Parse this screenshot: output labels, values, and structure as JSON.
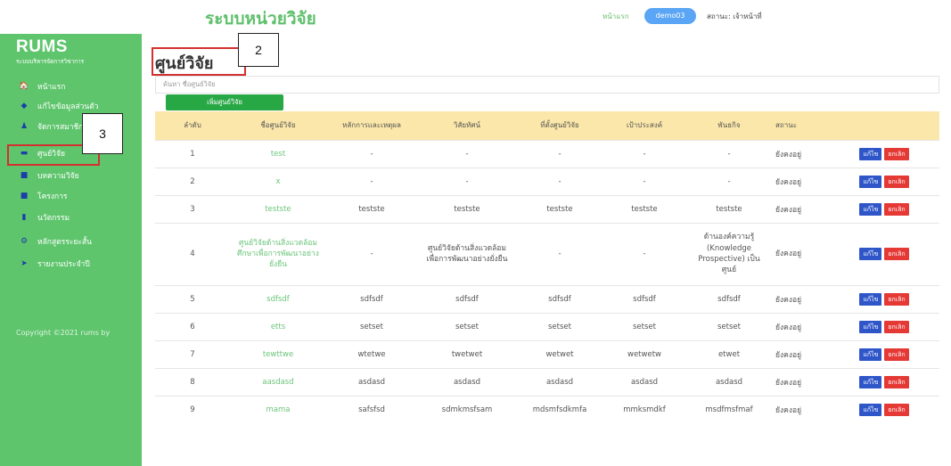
{
  "header": {
    "site_title": "ระบบหน่วยวิจัย",
    "home_link": "หน้าแรก",
    "user": "demo03",
    "status": "สถานะ: เจ้าหน้าที่"
  },
  "sidebar": {
    "brand": "RUMS",
    "brand_sub": "ระบบบริหารจัดการวิชาการ",
    "items": [
      {
        "label": "หน้าแรก",
        "icon": "home-icon",
        "glyph": "🏠"
      },
      {
        "label": "แก้ไขข้อมูลส่วนตัว",
        "icon": "gear-icon",
        "glyph": "◆"
      },
      {
        "label": "จัดการสมาชิก",
        "icon": "user-icon",
        "glyph": "♟"
      },
      {
        "label": "ศูนย์วิจัย",
        "icon": "building-icon",
        "glyph": "▬"
      },
      {
        "label": "บทความวิจัย",
        "icon": "book-icon",
        "glyph": "■"
      },
      {
        "label": "โครงการ",
        "icon": "folder-icon",
        "glyph": "■"
      },
      {
        "label": "นวัตกรรม",
        "icon": "bulb-icon",
        "glyph": "▮"
      },
      {
        "label": "หลักสูตรระยะสั้น",
        "icon": "cogs-icon",
        "glyph": "⚙"
      },
      {
        "label": "รายงานประจำปี",
        "icon": "send-icon",
        "glyph": "➤"
      }
    ],
    "copyright": "Copyright ©2021 rums by"
  },
  "main": {
    "title": "ศูนย์วิจัย",
    "search_placeholder": "ค้นหา ชื่อศูนย์วิจัย",
    "add_button": "เพิ่มศูนย์วิจัย",
    "columns": [
      "ลำดับ",
      "ชื่อศูนย์วิจัย",
      "หลักการและเหตุผล",
      "วิสัยทัศน์",
      "ที่ตั้งศูนย์วิจัย",
      "เป้าประสงค์",
      "พันธกิจ",
      "สถานะ",
      ""
    ],
    "edit_label": "แก้ไข",
    "delete_label": "ยกเลิก",
    "rows": [
      {
        "no": "1",
        "name": "test",
        "rationale": "-",
        "vision": "-",
        "location": "-",
        "goal": "-",
        "mission": "-",
        "status": "ยังคงอยู่"
      },
      {
        "no": "2",
        "name": "x",
        "rationale": "-",
        "vision": "-",
        "location": "-",
        "goal": "-",
        "mission": "-",
        "status": "ยังคงอยู่"
      },
      {
        "no": "3",
        "name": "teststе",
        "rationale": "teststе",
        "vision": "teststе",
        "location": "teststе",
        "goal": "teststе",
        "mission": "teststе",
        "status": "ยังคงอยู่"
      },
      {
        "no": "4",
        "name": "ศูนย์วิจัยด้านสิ่งแวดล้อมศึกษาเพื่อการพัฒนาอย่างยั่งยืน",
        "rationale": "-",
        "vision": "ศูนย์วิจัยด้านสิ่งแวดล้อมเพื่อการพัฒนาอย่างยั่งยืน",
        "location": "-",
        "goal": "-",
        "mission": "ด้านองค์ความรู้ (Knowledge Prospective) เป็นศูนย์",
        "status": "ยังคงอยู่"
      },
      {
        "no": "5",
        "name": "sdfsdf",
        "rationale": "sdfsdf",
        "vision": "sdfsdf",
        "location": "sdfsdf",
        "goal": "sdfsdf",
        "mission": "sdfsdf",
        "status": "ยังคงอยู่"
      },
      {
        "no": "6",
        "name": "etts",
        "rationale": "setset",
        "vision": "setset",
        "location": "setset",
        "goal": "setset",
        "mission": "setset",
        "status": "ยังคงอยู่"
      },
      {
        "no": "7",
        "name": "tewttwe",
        "rationale": "wtetwe",
        "vision": "twetwet",
        "location": "wetwet",
        "goal": "wetwetw",
        "mission": "etwet",
        "status": "ยังคงอยู่"
      },
      {
        "no": "8",
        "name": "aasdasd",
        "rationale": "asdasd",
        "vision": "asdasd",
        "location": "asdasd",
        "goal": "asdasd",
        "mission": "asdasd",
        "status": "ยังคงอยู่"
      },
      {
        "no": "9",
        "name": "mama",
        "rationale": "safsfsd",
        "vision": "sdmkmsfsam",
        "location": "mdsmfsdkmfa",
        "goal": "mmksmdkf",
        "mission": "msdfmsfmaf",
        "status": "ยังคงอยู่"
      }
    ]
  },
  "annotations": [
    {
      "label": "2",
      "target": "page-title"
    },
    {
      "label": "3",
      "target": "sidebar-item-research-center"
    }
  ],
  "colors": {
    "sidebar": "#5fc56d",
    "header_row": "#fbe7a9",
    "edit": "#2f56c9",
    "delete": "#e53935",
    "annotation": "#d32f2f"
  }
}
